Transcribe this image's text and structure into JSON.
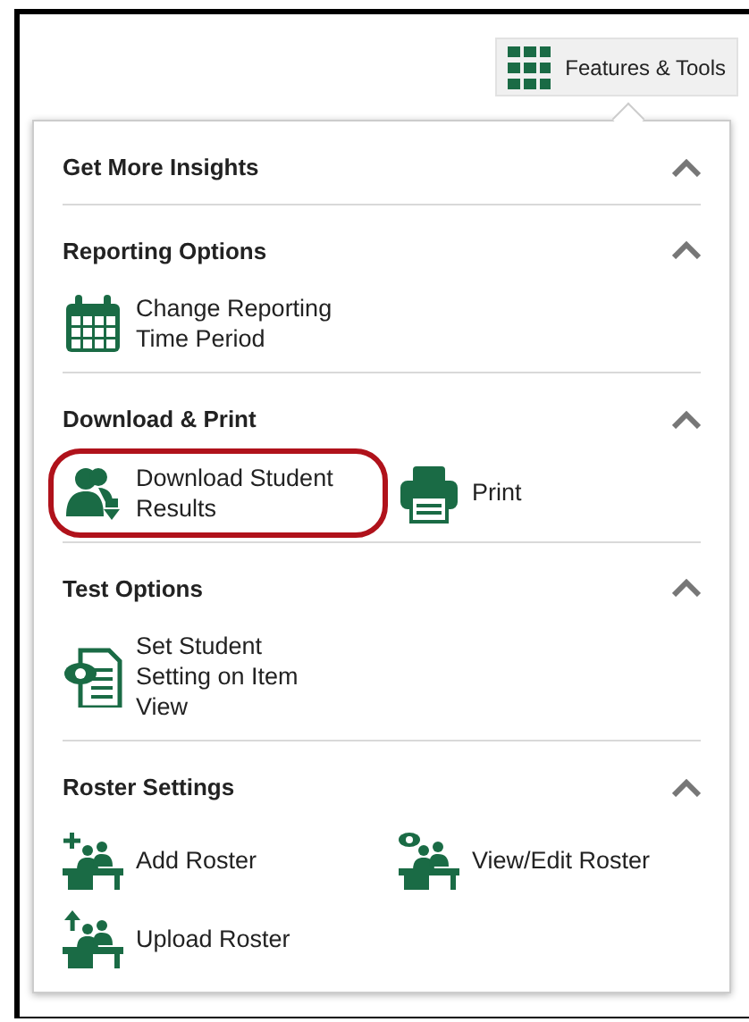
{
  "toolbar_button": {
    "label": "Features & Tools"
  },
  "sections": [
    {
      "title": "Get More Insights",
      "expanded": true
    },
    {
      "title": "Reporting Options",
      "expanded": true,
      "items": [
        {
          "kind": "calendar",
          "label": "Change Reporting Time Period",
          "highlighted": false
        }
      ]
    },
    {
      "title": "Download & Print",
      "expanded": true,
      "items": [
        {
          "kind": "download",
          "label": "Download Student Results",
          "highlighted": true
        },
        {
          "kind": "print",
          "label": "Print",
          "highlighted": false
        }
      ]
    },
    {
      "title": "Test Options",
      "expanded": true,
      "items": [
        {
          "kind": "document",
          "label": "Set Student Setting on Item View",
          "highlighted": false
        }
      ]
    },
    {
      "title": "Roster Settings",
      "expanded": true,
      "items": [
        {
          "kind": "add-roster",
          "label": "Add Roster",
          "highlighted": false
        },
        {
          "kind": "view-roster",
          "label": "View/Edit Roster",
          "highlighted": false
        },
        {
          "kind": "upload-roster",
          "label": "Upload Roster",
          "highlighted": false
        }
      ]
    }
  ]
}
